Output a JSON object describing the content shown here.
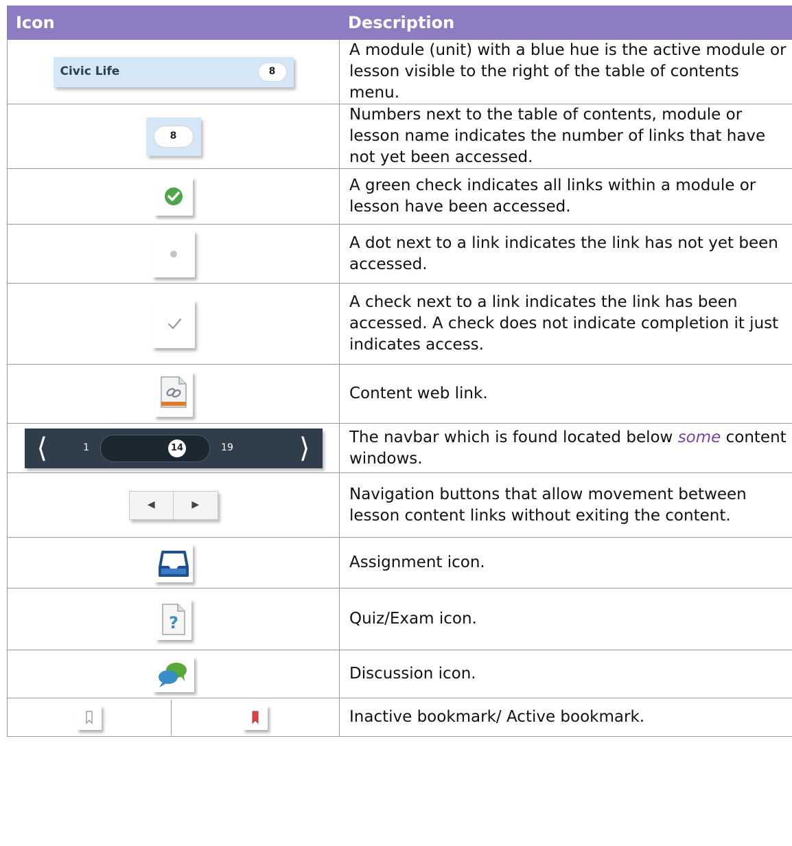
{
  "header": {
    "icon_col": "Icon",
    "desc_col": "Description"
  },
  "rows": [
    {
      "icon": "civic-life-module",
      "civic_title": "Civic Life",
      "civic_count": "8",
      "desc": " A module (unit) with a blue hue is the active module or lesson visible to the right of the table of contents menu."
    },
    {
      "icon": "unread-count-badge",
      "count": "8",
      "desc": "Numbers next to the table of contents, module or lesson name indicates the number of links that have not yet been accessed."
    },
    {
      "icon": "green-check-icon",
      "desc": "A green check indicates all links within a module or lesson have been accessed."
    },
    {
      "icon": "dot-icon",
      "desc": "A dot next to a link indicates the link has not yet been accessed."
    },
    {
      "icon": "check-icon",
      "desc": "A check next to a link indicates the link has been accessed.  A check does not indicate completion it just indicates access."
    },
    {
      "icon": "web-link-icon",
      "desc": "Content web link."
    },
    {
      "icon": "navbar",
      "nav_start": "1",
      "nav_current": "14",
      "nav_end": "19",
      "desc_before": "The navbar which is found located below ",
      "desc_em": "some",
      "desc_after": " content windows."
    },
    {
      "icon": "nav-buttons",
      "desc": "Navigation buttons that allow movement between lesson content links without exiting the content."
    },
    {
      "icon": "assignment-icon",
      "desc": "Assignment icon."
    },
    {
      "icon": "quiz-icon",
      "desc": "Quiz/Exam icon."
    },
    {
      "icon": "discussion-icon",
      "desc": "Discussion icon."
    },
    {
      "icon": "bookmark-icons",
      "desc": "Inactive bookmark/ Active bookmark."
    }
  ],
  "colors": {
    "header_bg": "#8e7cc3",
    "active_blue": "#d5e6f7",
    "navbar_bg": "#2f3e4a",
    "em_text": "#7a3fb0"
  }
}
